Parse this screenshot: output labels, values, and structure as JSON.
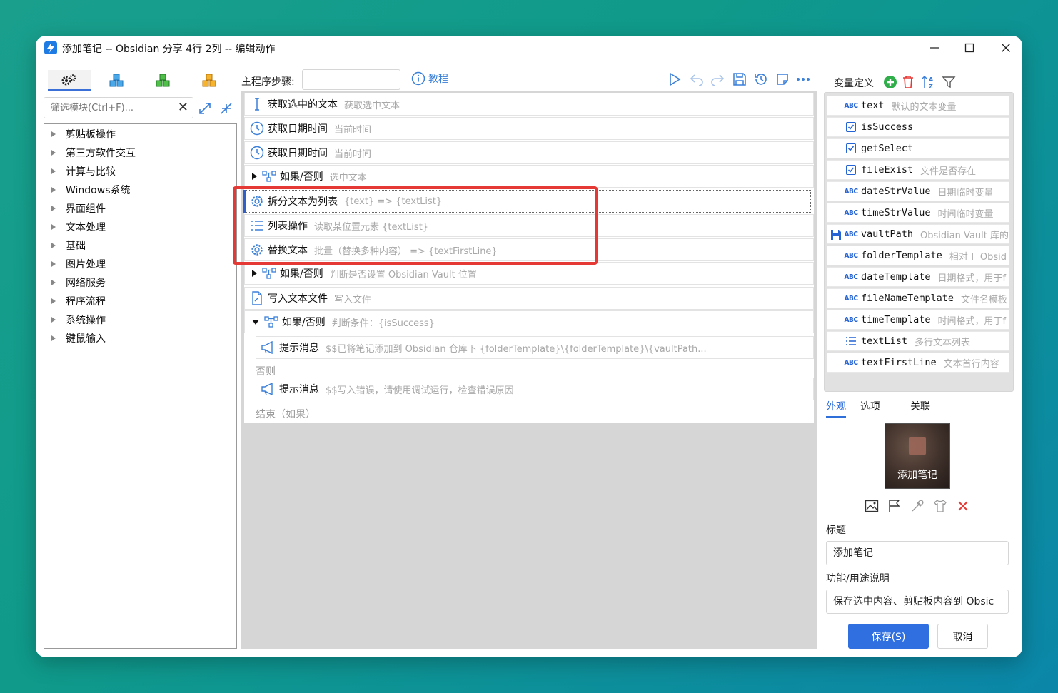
{
  "window": {
    "title": "添加笔记 -- Obsidian 分享 4行 2列 -- 编辑动作",
    "controls": {
      "minimize": "—",
      "maximize": "☐",
      "close": "✕"
    }
  },
  "left": {
    "module_tabs": [
      "gears-icon",
      "cubes-blue-icon",
      "cubes-green-icon",
      "cubes-orange-icon"
    ],
    "filter_placeholder": "筛选模块(Ctrl+F)...",
    "tree_items": [
      "剪贴板操作",
      "第三方软件交互",
      "计算与比较",
      "Windows系统",
      "界面组件",
      "文本处理",
      "基础",
      "图片处理",
      "网络服务",
      "程序流程",
      "系统操作",
      "键鼠输入"
    ]
  },
  "toolbar": {
    "main_steps_label": "主程序步骤:",
    "steps_input_value": "",
    "tutorial_label": "教程"
  },
  "steps": [
    {
      "name": "获取选中的文本",
      "desc": "获取选中文本",
      "icon": "text-cursor-icon"
    },
    {
      "name": "获取日期时间",
      "desc": "当前时间",
      "icon": "clock-icon"
    },
    {
      "name": "获取日期时间",
      "desc": "当前时间",
      "icon": "clock-icon"
    },
    {
      "name": "如果/否则",
      "desc": "选中文本",
      "icon": "branch-icon"
    },
    {
      "name": "拆分文本为列表",
      "desc": "{text} => {textList}",
      "icon": "gear-icon"
    },
    {
      "name": "列表操作",
      "desc": "读取某位置元素 {textList}",
      "icon": "list-icon"
    },
    {
      "name": "替换文本",
      "desc": "批量（替换多种内容） => {textFirstLine}",
      "icon": "gear-icon"
    },
    {
      "name": "如果/否则",
      "desc": "判断是否设置 Obsidian Vault 位置",
      "icon": "branch-icon"
    },
    {
      "name": "写入文本文件",
      "desc": "写入文件",
      "icon": "file-icon"
    },
    {
      "name": "如果/否则",
      "desc": "判断条件：{isSuccess}",
      "icon": "branch-icon"
    },
    {
      "name": "提示消息",
      "desc": "$$已将笔记添加到 Obsidian 仓库下 {folderTemplate}\\{folderTemplate}\\{vaultPath...",
      "icon": "megaphone-icon"
    },
    {
      "name": "提示消息",
      "desc": "$$写入错误，请使用调试运行，检查错误原因",
      "icon": "megaphone-icon"
    }
  ],
  "flow_labels": {
    "else": "否则",
    "end": "结束（如果）"
  },
  "variables": {
    "title": "变量定义",
    "items": [
      {
        "type": "ABC",
        "name": "text",
        "desc": "默认的文本变量"
      },
      {
        "type": "bool",
        "name": "isSuccess",
        "desc": ""
      },
      {
        "type": "bool",
        "name": "getSelect",
        "desc": ""
      },
      {
        "type": "bool",
        "name": "fileExist",
        "desc": "文件是否存在"
      },
      {
        "type": "ABC",
        "name": "dateStrValue",
        "desc": "日期临时变量"
      },
      {
        "type": "ABC",
        "name": "timeStrValue",
        "desc": "时间临时变量"
      },
      {
        "type": "ABC",
        "name": "vaultPath",
        "desc": "Obsidian Vault 库的"
      },
      {
        "type": "ABC",
        "name": "folderTemplate",
        "desc": "相对于 Obsid"
      },
      {
        "type": "ABC",
        "name": "dateTemplate",
        "desc": "日期格式，用于f"
      },
      {
        "type": "ABC",
        "name": "fileNameTemplate",
        "desc": "文件名模板"
      },
      {
        "type": "ABC",
        "name": "timeTemplate",
        "desc": "时间格式，用于f"
      },
      {
        "type": "list",
        "name": "textList",
        "desc": "多行文本列表"
      },
      {
        "type": "ABC",
        "name": "textFirstLine",
        "desc": "文本首行内容"
      }
    ]
  },
  "right_tabs": [
    "外观",
    "选项",
    "关联"
  ],
  "appearance": {
    "preview_label": "添加笔记",
    "title_label": "标题",
    "title_value": "添加笔记",
    "desc_label": "功能/用途说明",
    "desc_value": "保存选中内容、剪贴板内容到 Obsic"
  },
  "buttons": {
    "save": "保存(S)",
    "cancel": "取消"
  },
  "colors": {
    "accent": "#2f6fe0",
    "highlight_box": "#e53935",
    "desc_gray": "#a8a8a8"
  }
}
